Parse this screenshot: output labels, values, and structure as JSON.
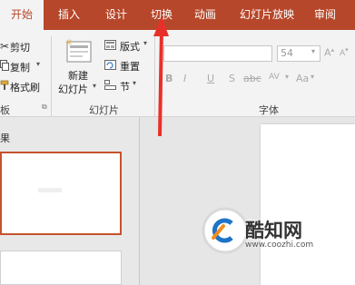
{
  "tabs": [
    "开始",
    "插入",
    "设计",
    "切换",
    "动画",
    "幻灯片放映",
    "审阅"
  ],
  "clipboard": {
    "cut": "剪切",
    "copy": "复制",
    "format_painter": "格式刷",
    "group_label_partial": "板"
  },
  "slides": {
    "new_slide_line1": "新建",
    "new_slide_line2": "幻灯片",
    "layout": "版式",
    "reset": "重置",
    "section": "节",
    "group_label": "幻灯片"
  },
  "font": {
    "size": "54",
    "group_label": "字体",
    "buttons": [
      "B",
      "I",
      "U",
      "S",
      "abc",
      "AV",
      "Aa"
    ]
  },
  "left_pane": {
    "label_partial": "果"
  },
  "watermark": {
    "name": "酷知网",
    "url": "www.coozhi.com"
  },
  "colors": {
    "accent": "#b7472a",
    "ribbon_bg": "#f3f3f3",
    "arrow": "#e8302a"
  }
}
